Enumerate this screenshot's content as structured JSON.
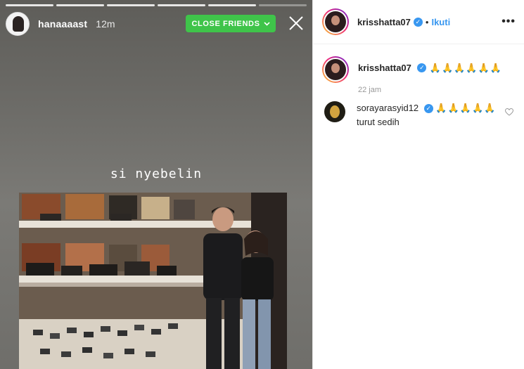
{
  "story": {
    "username": "hanaaaast",
    "time": "12m",
    "close_friends_label": "CLOSE FRIENDS",
    "caption": "si nyebelin",
    "progress_segments": 6,
    "accent_color": "#3fc44a"
  },
  "post": {
    "username": "krisshatta07",
    "follow_label": "Ikuti",
    "caption": "🙏🙏🙏🙏🙏🙏",
    "time": "22 jam",
    "verified": true
  },
  "comments": [
    {
      "username": "sorayarasyid12",
      "emoji": "🙏🙏🙏🙏🙏",
      "text": "turut sedih",
      "verified": true
    }
  ],
  "icons": {
    "close": "close-icon",
    "more": "more-options-icon",
    "heart": "heart-icon",
    "chevron": "chevron-down-icon",
    "verified": "verified-badge-icon"
  },
  "colors": {
    "link": "#3897f0",
    "close_friends": "#3fc44a"
  }
}
